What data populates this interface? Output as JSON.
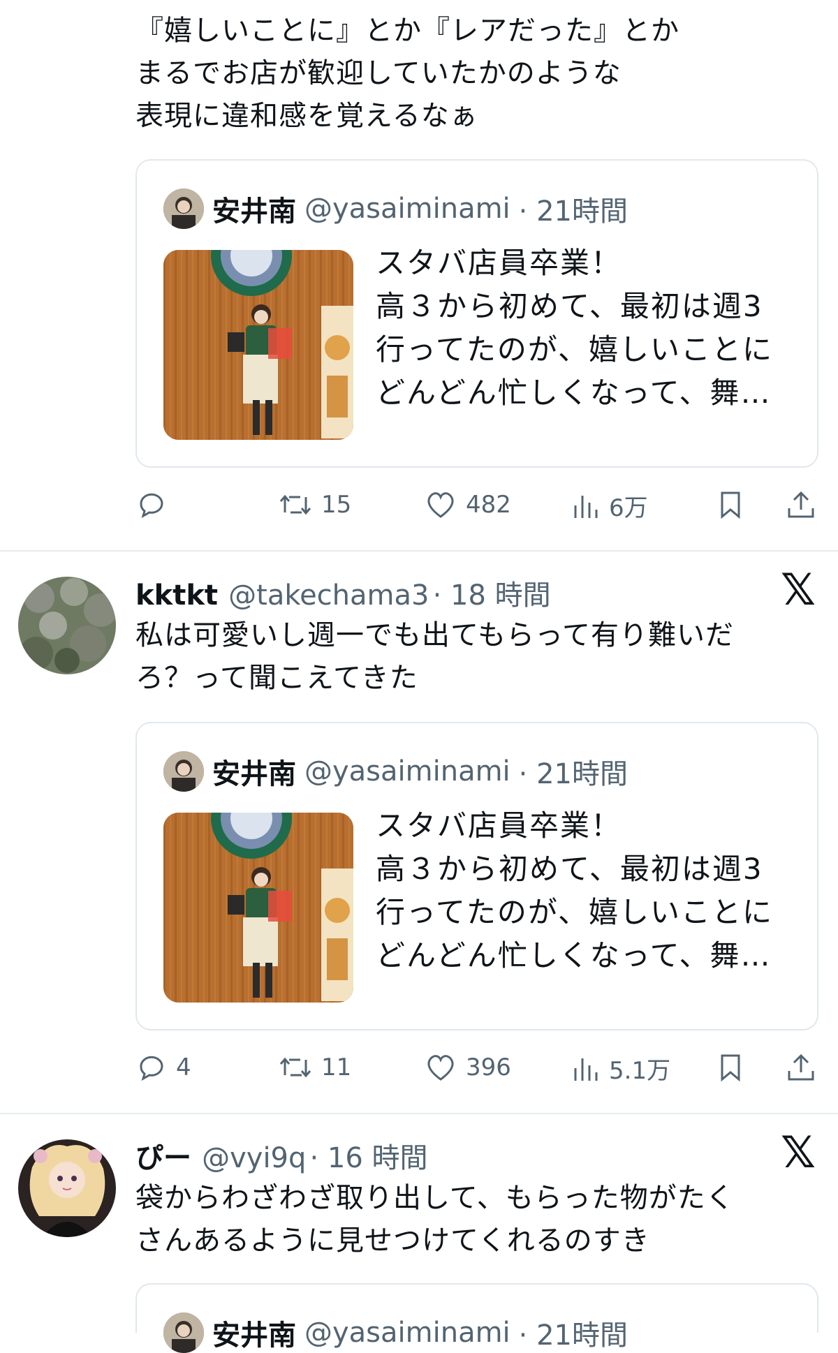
{
  "top_tweet": {
    "text": "『嬉しいことに』とか『レアだった』とか\nまるでお店が歓迎していたかのような\n表現に違和感を覚えるなぁ"
  },
  "quote": {
    "name": "安井南",
    "handle": "@yasaiminami",
    "time": "· 21時間",
    "text": "スタバ店員卒業！\n高３から初めて、最初は週3\n行ってたのが、嬉しいことに\nどんどん忙しくなって、舞…"
  },
  "tweets": [
    {
      "name": "",
      "handle": "",
      "time": "",
      "text": "",
      "actions": {
        "reply": "",
        "retweet": "15",
        "like": "482",
        "views": "6万"
      }
    },
    {
      "name": "kktkt",
      "handle": "@takechama3",
      "time": "· 18 時間",
      "text": "私は可愛いし週一でも出てもらって有り難いだ\nろ？って聞こえてきた",
      "actions": {
        "reply": "4",
        "retweet": "11",
        "like": "396",
        "views": "5.1万"
      }
    },
    {
      "name": "ぴー",
      "handle": "@vyi9q",
      "time": "· 16 時間",
      "text": "袋からわざわざ取り出して、もらった物がたく\nさんあるように見せつけてくれるのすき",
      "actions": {
        "reply": "",
        "retweet": "",
        "like": "",
        "views": ""
      }
    }
  ],
  "icons": {
    "reply": "reply-icon",
    "retweet": "retweet-icon",
    "like": "heart-icon",
    "views": "views-icon",
    "bookmark": "bookmark-icon",
    "share": "share-icon",
    "x_logo": "x-logo-icon"
  },
  "x_logo_glyph": "𝕏",
  "colors": {
    "text": "#0f1419",
    "secondary": "#536471",
    "border": "#e1e8ed"
  }
}
